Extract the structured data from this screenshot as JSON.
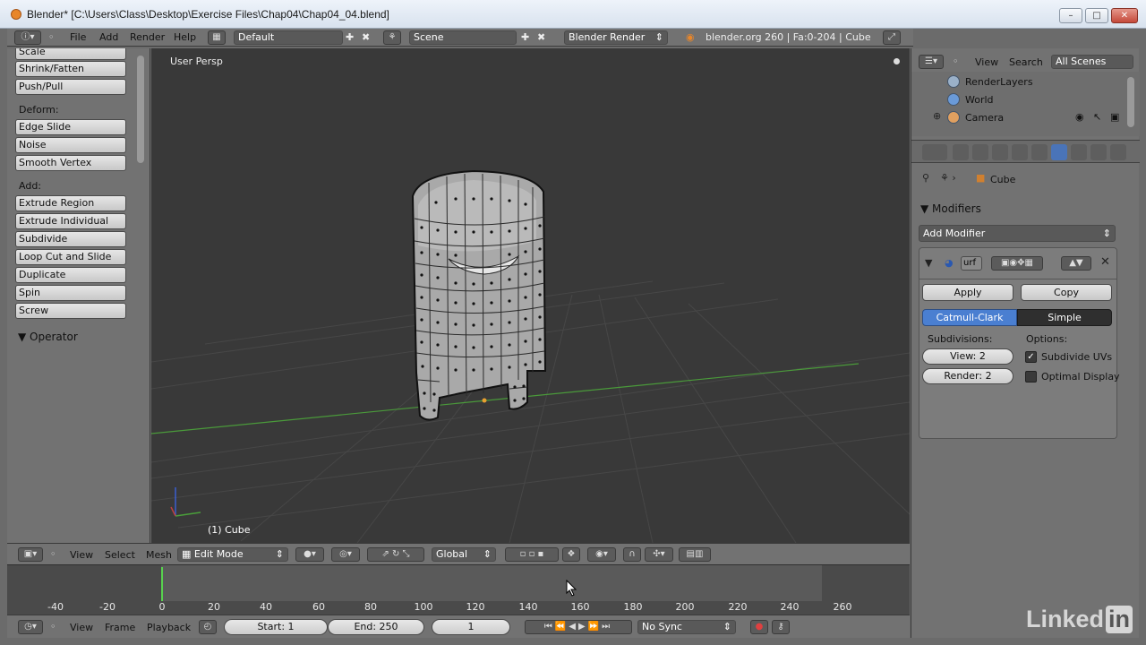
{
  "window": {
    "title": "Blender* [C:\\Users\\Class\\Desktop\\Exercise Files\\Chap04\\Chap04_04.blend]",
    "minimize": "–",
    "maximize": "□",
    "close": "✕"
  },
  "info_header": {
    "menus": [
      "File",
      "Add",
      "Render",
      "Help"
    ],
    "screen_layout": "Default",
    "scene": "Scene",
    "render_engine": "Blender Render",
    "stats": "blender.org 260 | Fa:0-204 | Cube"
  },
  "tool_shelf": {
    "transform_items": [
      "Scale",
      "Shrink/Fatten",
      "Push/Pull"
    ],
    "deform_label": "Deform:",
    "deform_items": [
      "Edge Slide",
      "Noise",
      "Smooth Vertex"
    ],
    "add_label": "Add:",
    "add_items": [
      "Extrude Region",
      "Extrude Individual",
      "Subdivide",
      "Loop Cut and Slide",
      "Duplicate",
      "Spin",
      "Screw"
    ],
    "operator_panel": "Operator"
  },
  "viewport": {
    "view_label": "User Persp",
    "object_label": "(1) Cube"
  },
  "view3d_header": {
    "menus": [
      "View",
      "Select",
      "Mesh"
    ],
    "mode": "Edit Mode",
    "orientation": "Global"
  },
  "timeline": {
    "ticks": [
      "-40",
      "-20",
      "0",
      "20",
      "40",
      "60",
      "80",
      "100",
      "120",
      "140",
      "160",
      "180",
      "200",
      "220",
      "240",
      "260"
    ],
    "menus": [
      "View",
      "Frame",
      "Playback"
    ],
    "start": "Start: 1",
    "end": "End: 250",
    "current_frame": "1",
    "sync": "No Sync"
  },
  "outliner": {
    "menus": [
      "View",
      "Search"
    ],
    "filter": "All Scenes",
    "items": [
      "RenderLayers",
      "World",
      "Camera"
    ]
  },
  "properties": {
    "breadcrumb": "Cube",
    "panel": "Modifiers",
    "add_modifier": "Add Modifier",
    "modifier_name": "urf",
    "apply": "Apply",
    "copy": "Copy",
    "catmull_clark": "Catmull-Clark",
    "simple": "Simple",
    "subdivisions_label": "Subdivisions:",
    "options_label": "Options:",
    "view_levels": "View: 2",
    "render_levels": "Render: 2",
    "subdivide_uvs": "Subdivide UVs",
    "optimal_display": "Optimal Display"
  },
  "watermark": {
    "text": "Linked",
    "box": "in"
  },
  "colors": {
    "accent_blue": "#4a7fd1",
    "playhead_green": "#58d14e",
    "viewport_bg": "#393939"
  }
}
